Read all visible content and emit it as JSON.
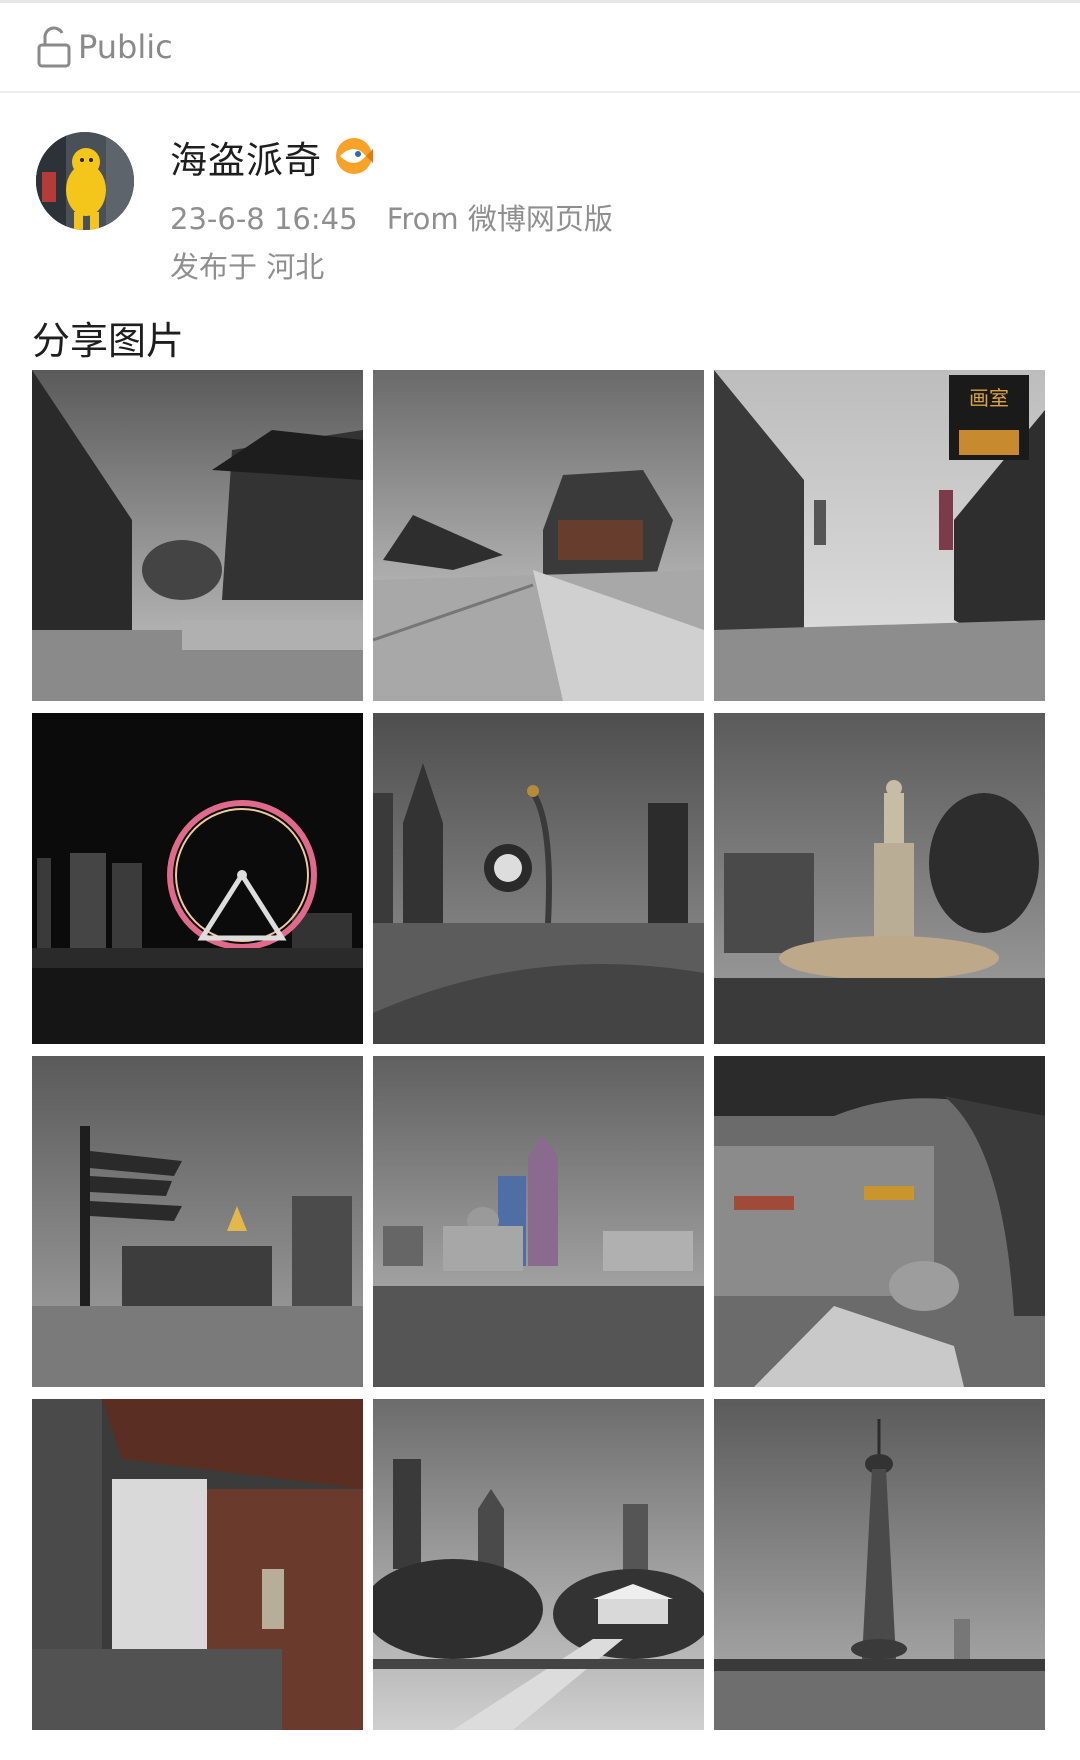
{
  "visibility": {
    "label": "Public",
    "icon": "unlock-icon"
  },
  "post": {
    "user_name": "海盗派奇",
    "badge_icon": "fish-badge-icon",
    "timestamp": "23-6-8 16:45",
    "source": "From 微博网页版",
    "location": "发布于 河北",
    "section_title": "分享图片"
  },
  "photos": [
    {
      "name": "photo-temple-courtyard",
      "sign": ""
    },
    {
      "name": "photo-modern-building-walkway",
      "sign": ""
    },
    {
      "name": "photo-old-street",
      "sign": "画室"
    },
    {
      "name": "photo-ferris-wheel-night",
      "sign": ""
    },
    {
      "name": "photo-clock-sculpture",
      "sign": ""
    },
    {
      "name": "photo-statue-fountain",
      "sign": ""
    },
    {
      "name": "photo-signpost-plaza",
      "sign": ""
    },
    {
      "name": "photo-domed-building-skyline",
      "sign": ""
    },
    {
      "name": "photo-arcade-market",
      "sign": ""
    },
    {
      "name": "photo-porcelain-house-interior",
      "sign": ""
    },
    {
      "name": "photo-park-skyline",
      "sign": ""
    },
    {
      "name": "photo-tv-tower",
      "sign": ""
    }
  ]
}
